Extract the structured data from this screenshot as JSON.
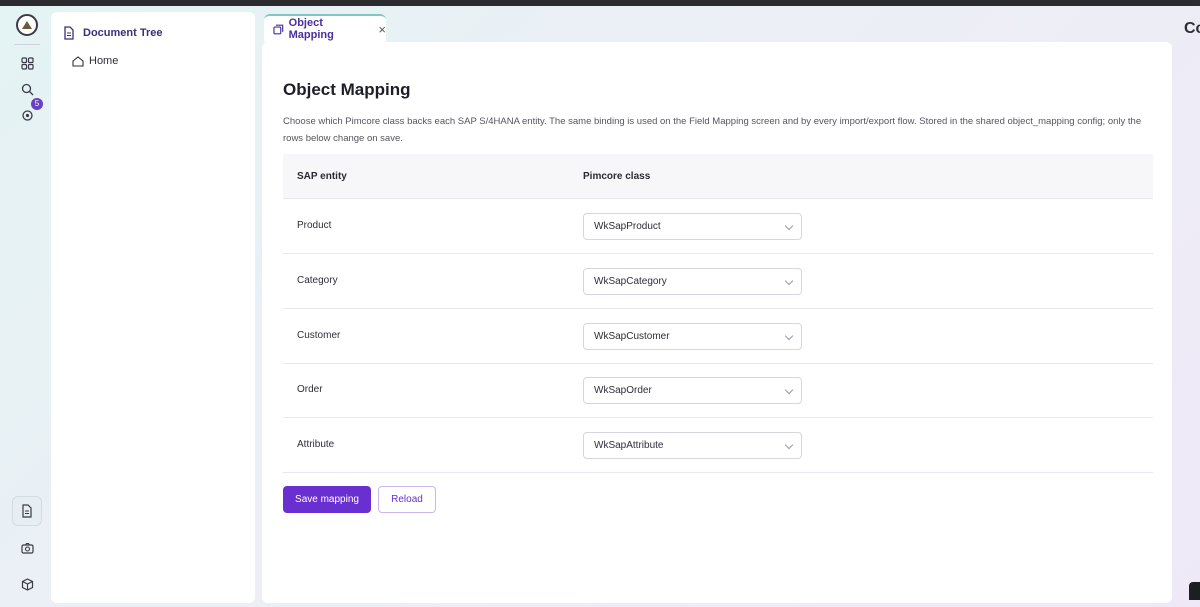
{
  "sidebar": {
    "title": "Document Tree",
    "items": [
      {
        "label": "Home"
      }
    ]
  },
  "rail": {
    "badge_count": "5",
    "icons": [
      "grid-icon",
      "search-icon",
      "settings-icon",
      "document-icon",
      "camera-icon",
      "cube-icon"
    ]
  },
  "tab": {
    "label": "Object Mapping",
    "close": "×"
  },
  "brand": {
    "label": "Cc"
  },
  "main": {
    "title": "Object Mapping",
    "description": "Choose which Pimcore class backs each SAP S/4HANA entity. The same binding is used on the Field Mapping screen and by every import/export flow. Stored in the shared object_mapping config; only the rows below change on save.",
    "table": {
      "headers": {
        "entity": "SAP entity",
        "class": "Pimcore class"
      },
      "rows": [
        {
          "entity": "Product",
          "class": "WkSapProduct"
        },
        {
          "entity": "Category",
          "class": "WkSapCategory"
        },
        {
          "entity": "Customer",
          "class": "WkSapCustomer"
        },
        {
          "entity": "Order",
          "class": "WkSapOrder"
        },
        {
          "entity": "Attribute",
          "class": "WkSapAttribute"
        }
      ]
    },
    "save_label": "Save mapping",
    "reload_label": "Reload"
  },
  "colors": {
    "accent": "#6a2fd0",
    "tab_border": "#7fc7c3"
  }
}
